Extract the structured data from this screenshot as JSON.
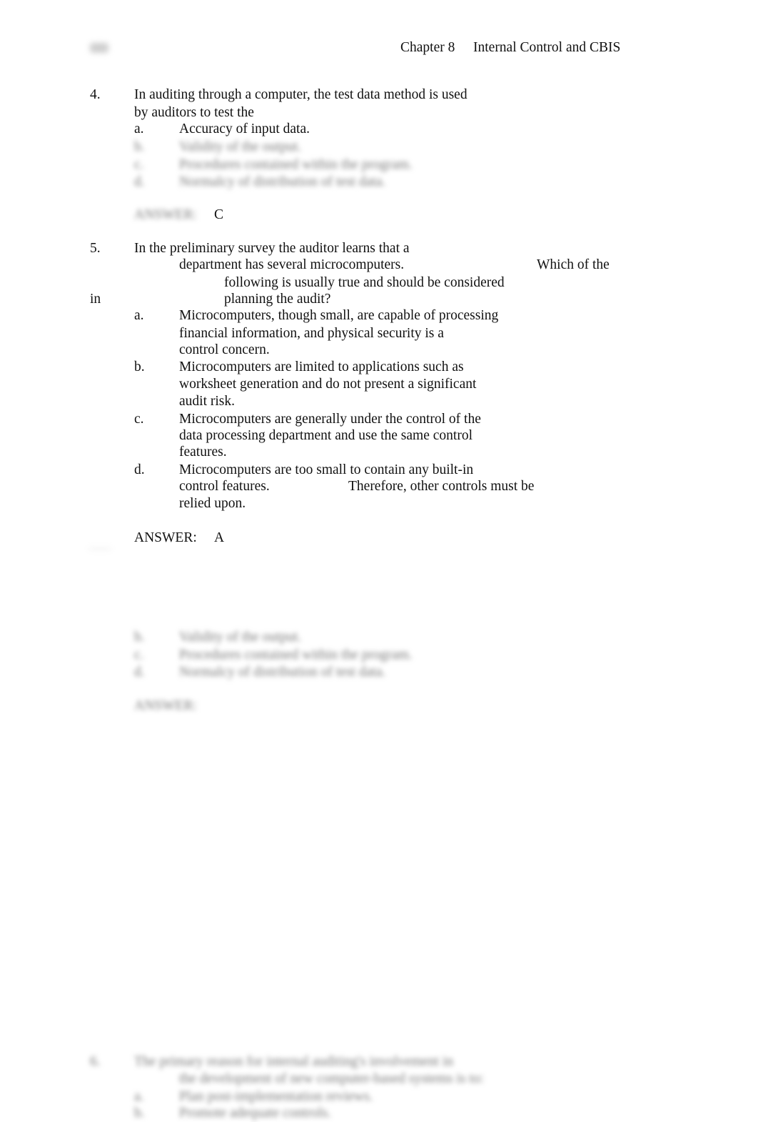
{
  "header": {
    "page_number": "",
    "chapter": "Chapter 8",
    "title": "Internal Control and CBIS"
  },
  "question4": {
    "number": "4.",
    "stem_lines": [
      "In auditing through a computer, the test data method is used",
      "by auditors to test the"
    ],
    "options": [
      {
        "letter": "a.",
        "text": "Accuracy of input data."
      },
      {
        "letter": "b.",
        "text": "Validity of the output."
      },
      {
        "letter": "c.",
        "text": "Procedures contained within the program."
      },
      {
        "letter": "d.",
        "text": "Normalcy of distribution of test data."
      }
    ],
    "answer_label": "ANSWER:",
    "answer": "C"
  },
  "question5": {
    "number": "5.",
    "stem_line1": "In the preliminary survey the auditor learns that a",
    "stem_line2": "department has several microcomputers.",
    "stem_line2_right": "Which of the",
    "stem_line3": "following is usually true and should be considered",
    "stem_line4_left": "in",
    "stem_line4": "planning the audit?",
    "options": [
      {
        "letter": "a.",
        "lines": [
          "Microcomputers, though small, are capable of processing",
          "financial information, and physical security is a",
          "control concern."
        ]
      },
      {
        "letter": "b.",
        "lines": [
          "Microcomputers are limited to applications such as",
          "worksheet generation and do not present a significant",
          "audit risk."
        ]
      },
      {
        "letter": "c.",
        "lines": [
          "Microcomputers are generally under the control of the",
          "data processing department and use the same control",
          "features."
        ]
      },
      {
        "letter": "d.",
        "lines": [
          "Microcomputers are too small to contain any built-in",
          "control features.",
          "relied upon."
        ],
        "line2_right": "Therefore, other controls must be"
      }
    ],
    "answer_label": "ANSWER:",
    "answer": "A"
  },
  "blurred_section": {
    "options": [
      {
        "letter": "b.",
        "text": "Validity of the output."
      },
      {
        "letter": "c.",
        "text": "Procedures contained within the program."
      },
      {
        "letter": "d.",
        "text": "Normalcy of distribution of test data."
      }
    ],
    "answer_label": "ANSWER:"
  },
  "blurred_question6": {
    "number": "6.",
    "stem_lines": [
      "The primary reason for internal auditing's involvement in",
      "the development of new computer-based systems is to:"
    ],
    "options": [
      {
        "letter": "a.",
        "text": "Plan post-implementation reviews."
      },
      {
        "letter": "b.",
        "text": "Promote adequate controls."
      }
    ]
  }
}
